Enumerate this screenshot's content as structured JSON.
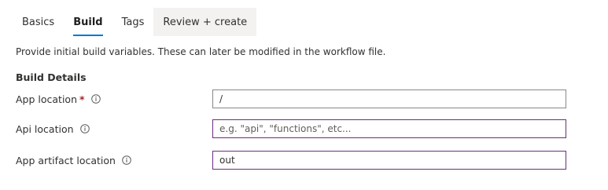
{
  "tabs": [
    {
      "label": "Basics",
      "active": false
    },
    {
      "label": "Build",
      "active": true
    },
    {
      "label": "Tags",
      "active": false
    },
    {
      "label": "Review + create",
      "active": false
    }
  ],
  "intro_text": "Provide initial build variables. These can later be modified in the workflow file.",
  "section_title": "Build Details",
  "fields": {
    "app_location": {
      "label": "App location",
      "required_marker": "*",
      "value": "/",
      "placeholder": ""
    },
    "api_location": {
      "label": "Api location",
      "value": "",
      "placeholder": "e.g. \"api\", \"functions\", etc..."
    },
    "app_artifact_location": {
      "label": "App artifact location",
      "value": "out",
      "placeholder": ""
    }
  },
  "colors": {
    "accent": "#0078d4",
    "required": "#a4262c",
    "input_focus_border": "#6b2e7f",
    "input_border": "#8a8886"
  },
  "icons": {
    "info": "info-icon"
  }
}
